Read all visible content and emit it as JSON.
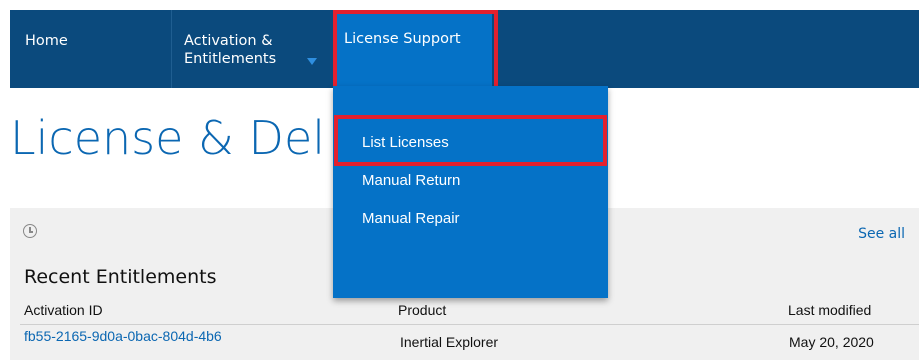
{
  "nav": {
    "home": "Home",
    "activation": "Activation & Entitlements",
    "license_support": "License Support"
  },
  "page": {
    "title": "License & Del"
  },
  "dropdown": {
    "items": [
      {
        "label": "List Licenses"
      },
      {
        "label": "Manual Return"
      },
      {
        "label": "Manual Repair"
      }
    ]
  },
  "panel": {
    "see_all": "See all",
    "heading": "Recent Entitlements",
    "columns": {
      "activation_id": "Activation ID",
      "product": "Product",
      "last_modified": "Last modified"
    },
    "rows": [
      {
        "activation_id": "fb55-2165-9d0a-0bac-804d-4b6",
        "product": "Inertial Explorer",
        "last_modified": "May 20, 2020"
      }
    ]
  },
  "colors": {
    "nav_bg": "#0b4a7d",
    "dropdown_bg": "#0572c7",
    "highlight": "#e3202e",
    "title": "#0b67b2"
  }
}
